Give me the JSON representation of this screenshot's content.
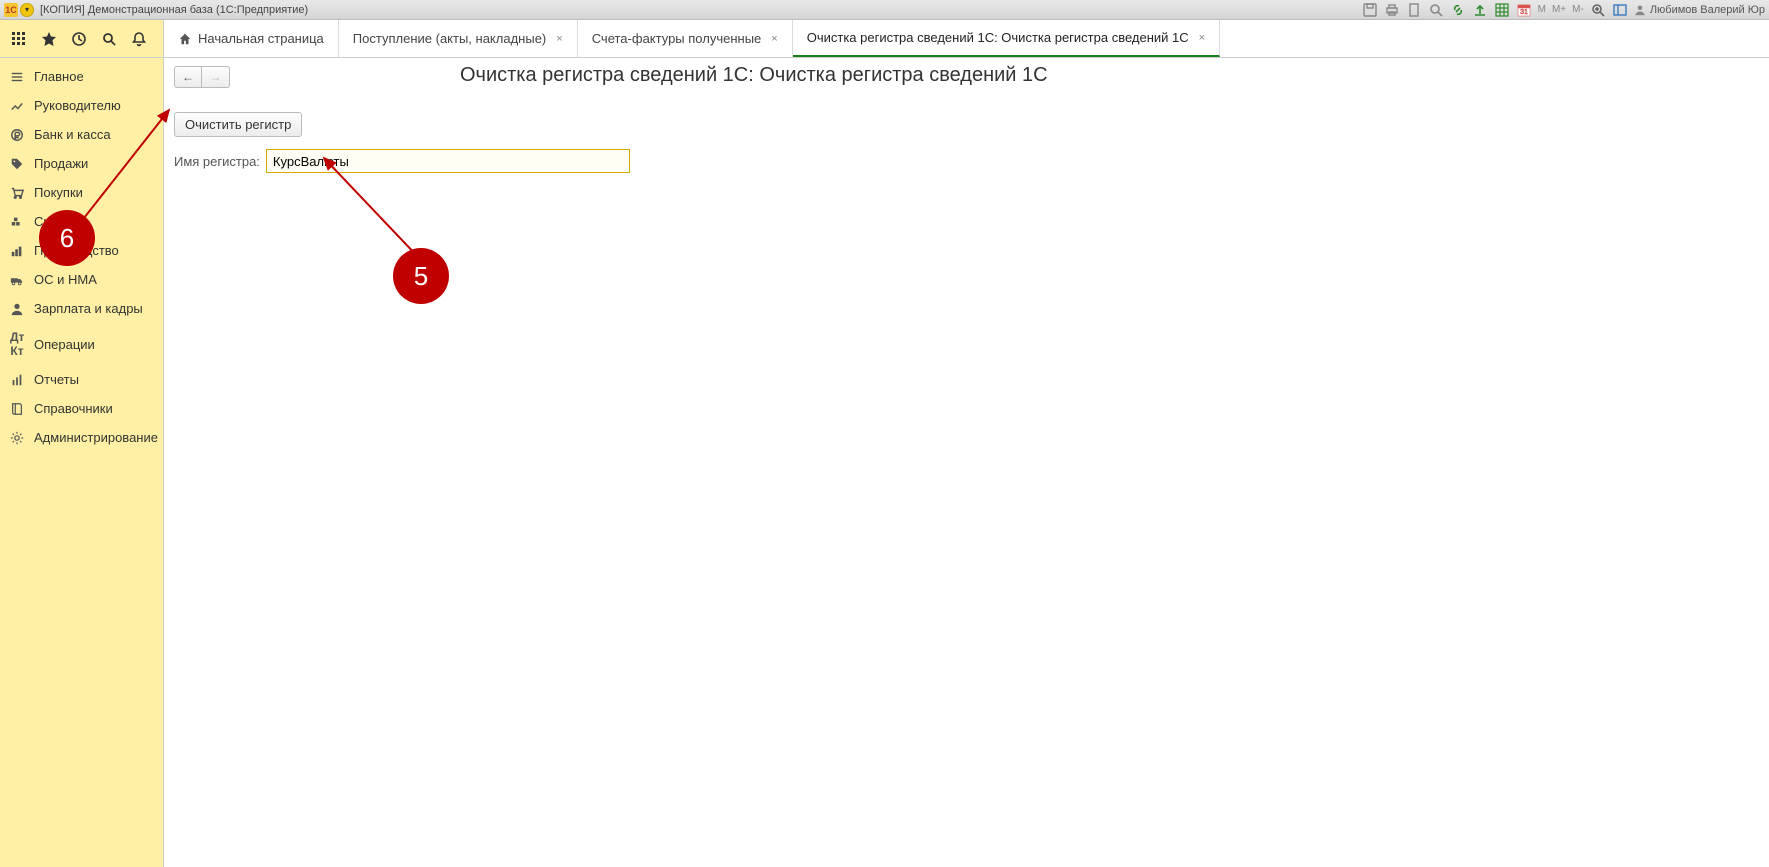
{
  "titlebar": {
    "app_logo": "1С",
    "title": "[КОПИЯ] Демонстрационная база  (1С:Предприятие)",
    "m_labels": [
      "M",
      "M+",
      "M-"
    ],
    "user_name": "Любимов Валерий Юр"
  },
  "tabs": {
    "home": "Начальная страница",
    "t1": "Поступление (акты, накладные)",
    "t2": "Счета-фактуры полученные",
    "t3": "Очистка регистра сведений 1С: Очистка регистра сведений 1С"
  },
  "sidebar": {
    "items": [
      "Главное",
      "Руководителю",
      "Банк и касса",
      "Продажи",
      "Покупки",
      "Склад",
      "Производство",
      "ОС и НМА",
      "Зарплата и кадры",
      "Операции",
      "Отчеты",
      "Справочники",
      "Администрирование"
    ]
  },
  "content": {
    "page_title": "Очистка регистра сведений 1С: Очистка регистра сведений 1С",
    "clear_button": "Очистить регистр",
    "field_label": "Имя регистра:",
    "field_value": "КурсВалюты"
  },
  "annotations": {
    "c5": "5",
    "c6": "6"
  }
}
